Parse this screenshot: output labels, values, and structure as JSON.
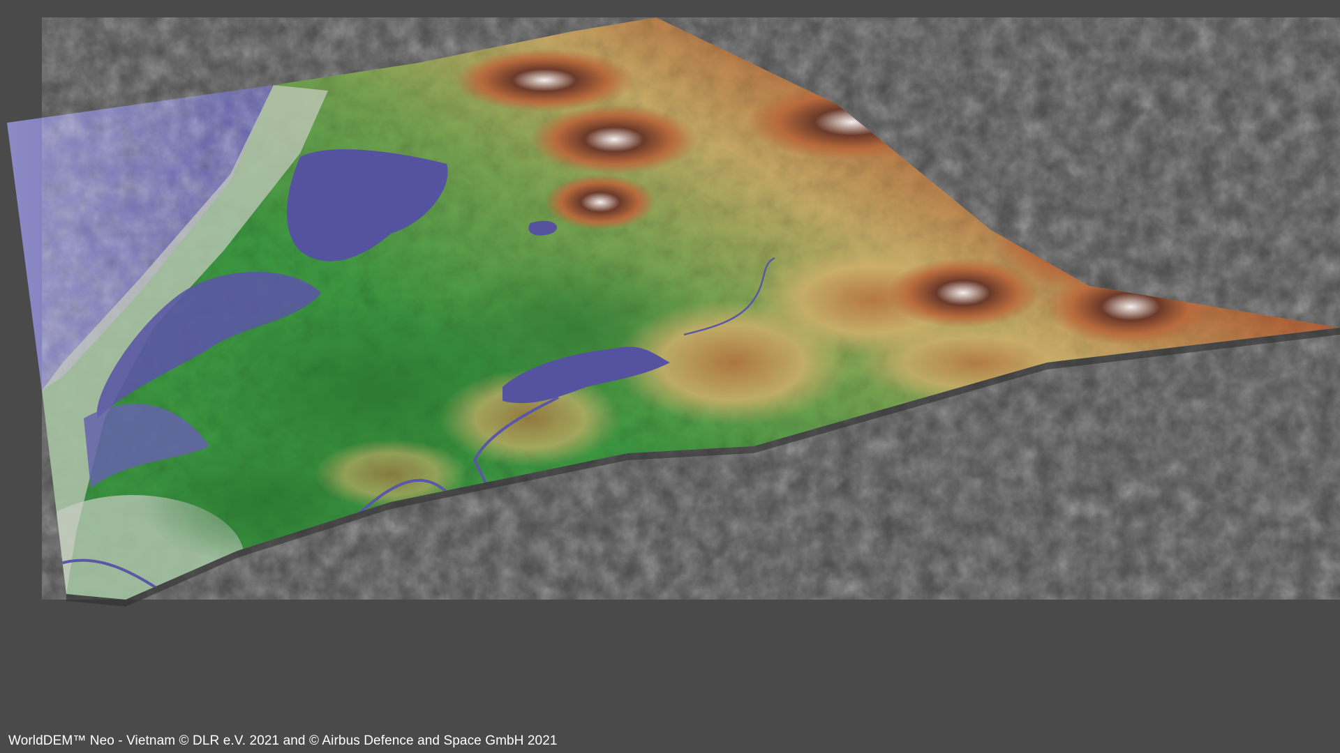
{
  "credit": "WorldDEM™ Neo - Vietnam © DLR e.V. 2021 and © Airbus Defence and Space GmbH 2021",
  "colors": {
    "background": "#4a4a4a",
    "water": "#55529f",
    "water_light": "#7b7ab8",
    "lowland_green": "#3f9a45",
    "forest_green": "#2f7f35",
    "hill_yellow": "#c8b36a",
    "mountain_orange": "#b96a3c",
    "peak_brown": "#5a2f22",
    "snow_white": "#f2f2f2",
    "urban_grey": "#c9cdc4"
  }
}
